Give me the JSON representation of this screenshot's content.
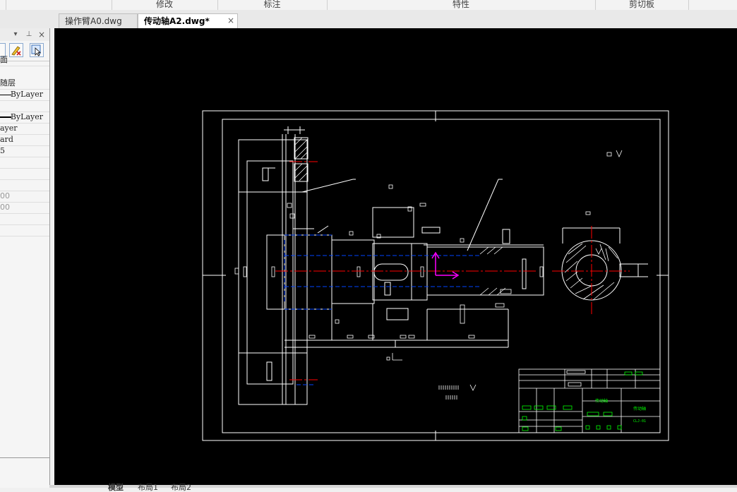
{
  "ribbon": {
    "groups": [
      "修改",
      "标注",
      "特性",
      "剪切板"
    ]
  },
  "document_tabs": [
    {
      "label": "操作臂A0.dwg",
      "active": false
    },
    {
      "label": "传动轴A2.dwg*",
      "active": true
    }
  ],
  "tab_close_glyph": "×",
  "properties_panel": {
    "header_controls": {
      "dropdown": "▾",
      "pin": "⊥",
      "close": "×"
    },
    "tool_icons": [
      "quick-select-icon",
      "pick-add-icon"
    ],
    "rows": {
      "row1": "面",
      "row2": "随层",
      "row3": "ByLayer",
      "row5": "ByLayer",
      "row6": "ayer",
      "row7": "ard",
      "row8": "5",
      "row12": "00",
      "row13": "00"
    }
  },
  "layout_tabs": [
    "模型",
    "布局1",
    "布局2"
  ],
  "colors": {
    "canvas": "#000000",
    "lines": "#ffffff",
    "centerline": "#ff0000",
    "hidden_line": "#0000ff",
    "ucs": "#ff00ff",
    "title_block_text": "#00ff00"
  },
  "drawing": {
    "title_block_text": {
      "name": "传动轴",
      "code": "CLJ-01"
    }
  }
}
